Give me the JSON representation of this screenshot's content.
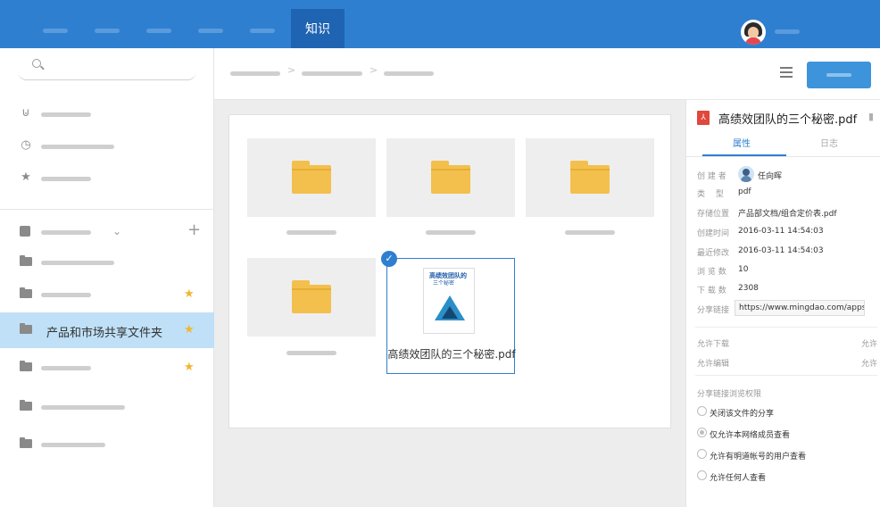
{
  "topbar": {
    "active_tab": "知识"
  },
  "sidebar": {
    "selected_folder": "产品和市场共享文件夹"
  },
  "selected_file": {
    "name": "高绩效团队的三个秘密.pdf",
    "cover_title": "高绩效团队的",
    "cover_subtitle": "三个秘密"
  },
  "detail": {
    "title": "高绩效团队的三个秘密.pdf",
    "tabs": [
      "属性",
      "日志"
    ],
    "props": [
      {
        "label": "创 建 者",
        "value": "任向晖"
      },
      {
        "label": "类　 型",
        "value": "pdf"
      },
      {
        "label": "存储位置",
        "value": "产品部文档/组合定价表.pdf"
      },
      {
        "label": "创建时间",
        "value": "2016-03-11 14:54:03"
      },
      {
        "label": "最近修改",
        "value": "2016-03-11 14:54:03"
      },
      {
        "label": "浏 览 数",
        "value": "10"
      },
      {
        "label": "下 载 数",
        "value": "2308"
      }
    ],
    "share_label": "分享链接",
    "share_url": "https://www.mingdao.com/apps/kcs/s",
    "permissions": [
      {
        "label": "允许下载",
        "value": "允许"
      },
      {
        "label": "允许编辑",
        "value": "允许"
      }
    ],
    "share_perm_title": "分享链接浏览权限",
    "radios": [
      "关闭该文件的分享",
      "仅允许本网络成员查看",
      "允许有明道帐号的用户查看",
      "允许任何人查看"
    ]
  },
  "colors": {
    "topbar": "#2F7FD0",
    "active_tab": "#1F64B3",
    "folder": "#F3C04D",
    "star": "#F2B530",
    "selected_row": "#BFE0F6",
    "pdf_red": "#E0473D"
  }
}
